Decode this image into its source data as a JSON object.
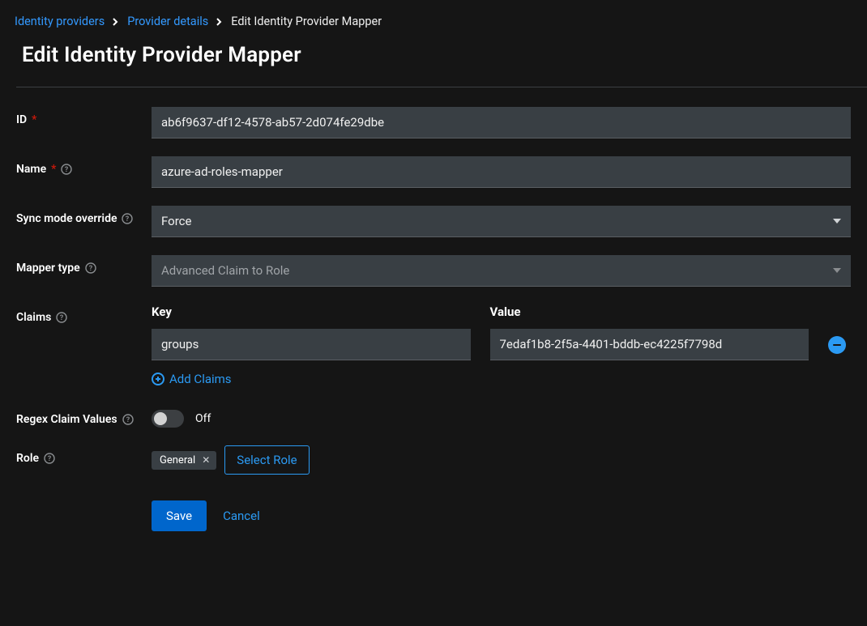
{
  "breadcrumb": {
    "items": [
      {
        "label": "Identity providers"
      },
      {
        "label": "Provider details"
      }
    ],
    "current": "Edit Identity Provider Mapper"
  },
  "page": {
    "title": "Edit Identity Provider Mapper"
  },
  "form": {
    "id": {
      "label": "ID",
      "required": "*",
      "value": "ab6f9637-df12-4578-ab57-2d074fe29dbe"
    },
    "name": {
      "label": "Name",
      "required": "*",
      "value": "azure-ad-roles-mapper"
    },
    "syncMode": {
      "label": "Sync mode override",
      "value": "Force"
    },
    "mapperType": {
      "label": "Mapper type",
      "value": "Advanced Claim to Role"
    },
    "claims": {
      "label": "Claims",
      "keyHeader": "Key",
      "valueHeader": "Value",
      "rows": [
        {
          "key": "groups",
          "value": "7edaf1b8-2f5a-4401-bddb-ec4225f7798d"
        }
      ],
      "addLabel": "Add Claims"
    },
    "regex": {
      "label": "Regex Claim Values",
      "stateLabel": "Off"
    },
    "role": {
      "label": "Role",
      "chip": "General",
      "selectLabel": "Select Role"
    },
    "actions": {
      "save": "Save",
      "cancel": "Cancel"
    }
  }
}
